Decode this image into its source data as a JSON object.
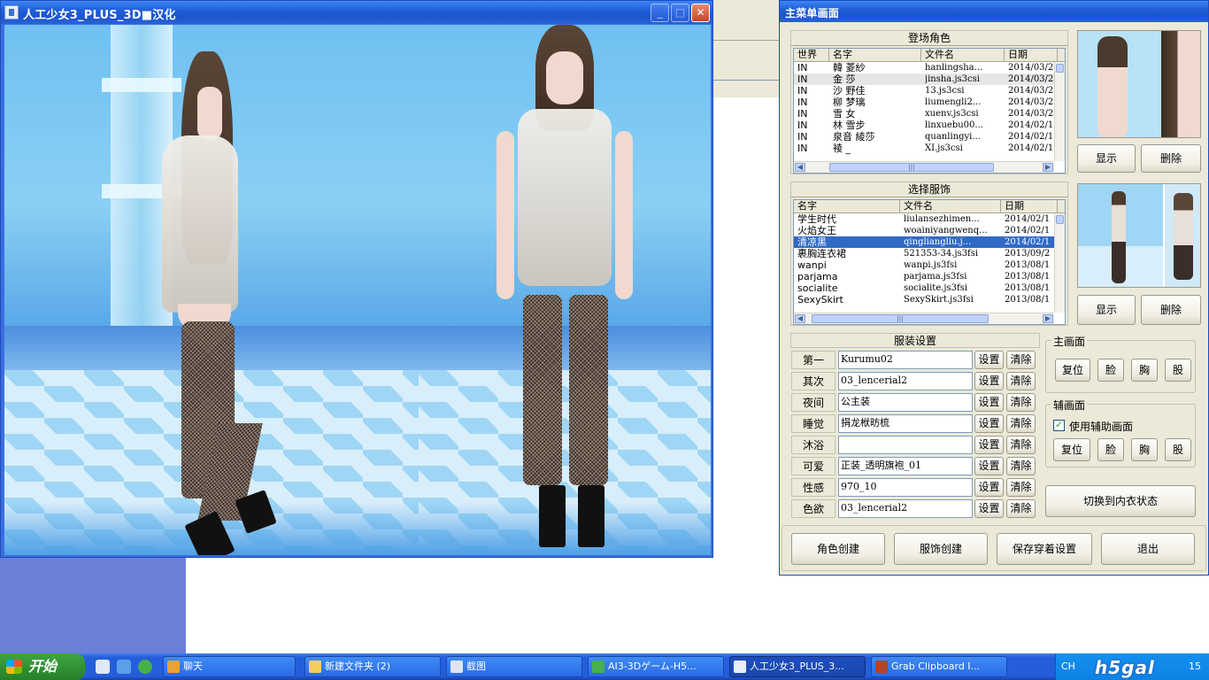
{
  "game_window": {
    "title": "人工少女3_PLUS_3D■汉化",
    "min_label": "_",
    "max_label": "□",
    "close_label": "✕"
  },
  "main_menu": {
    "title": "主菜单画面",
    "characters": {
      "header": "登场角色",
      "columns": [
        "世界",
        "名字",
        "文件名",
        "日期"
      ],
      "rows": [
        {
          "world": "IN",
          "name": "韓 菱紗",
          "file": "hanlingsha...",
          "date": "2014/03/2"
        },
        {
          "world": "IN",
          "name": "金 莎",
          "file": "jinsha.js3csi",
          "date": "2014/03/2"
        },
        {
          "world": "IN",
          "name": "沙 野佳",
          "file": "13.js3csi",
          "date": "2014/03/2"
        },
        {
          "world": "IN",
          "name": "柳 梦璃",
          "file": "liumengli2...",
          "date": "2014/03/2"
        },
        {
          "world": "IN",
          "name": "雪 女",
          "file": "xuenv.js3csi",
          "date": "2014/03/2"
        },
        {
          "world": "IN",
          "name": "林 雪步",
          "file": "linxuebu00...",
          "date": "2014/02/1"
        },
        {
          "world": "IN",
          "name": "泉音 綾莎",
          "file": "quanlingyi...",
          "date": "2014/02/1"
        },
        {
          "world": "IN",
          "name": "祾 _",
          "file": "XI.js3csi",
          "date": "2014/02/1"
        }
      ],
      "show_label": "显示",
      "delete_label": "删除"
    },
    "outfits": {
      "header": "选择服饰",
      "columns": [
        "名字",
        "文件名",
        "日期"
      ],
      "rows": [
        {
          "name": "学生时代",
          "file": "liulansezhimen...",
          "date": "2014/02/1"
        },
        {
          "name": "火焰女王",
          "file": "woainiyangwenq...",
          "date": "2014/02/1"
        },
        {
          "name": "清凉黑",
          "file": "qingliangliu.j...",
          "date": "2014/02/1"
        },
        {
          "name": "裹胸连衣裙",
          "file": "521353-34.js3fsi",
          "date": "2013/09/2"
        },
        {
          "name": "wanpi",
          "file": "wanpi.js3fsi",
          "date": "2013/08/1"
        },
        {
          "name": "parjama",
          "file": "parjama.js3fsi",
          "date": "2013/08/1"
        },
        {
          "name": "socialite",
          "file": "socialite.js3fsi",
          "date": "2013/08/1"
        },
        {
          "name": "SexySkirt",
          "file": "SexySkirt.js3fsi",
          "date": "2013/08/1"
        }
      ],
      "selected_index": 2,
      "show_label": "显示",
      "delete_label": "删除"
    },
    "costume_settings": {
      "header": "服装设置",
      "set_label": "设置",
      "clear_label": "清除",
      "slots": [
        {
          "label": "第一",
          "value": "Kurumu02"
        },
        {
          "label": "其次",
          "value": "03_lencerial2"
        },
        {
          "label": "夜间",
          "value": "公主装"
        },
        {
          "label": "睡觉",
          "value": "捐龙栿昉梳"
        },
        {
          "label": "沐浴",
          "value": ""
        },
        {
          "label": "可爱",
          "value": "正装_透明旗袍_01"
        },
        {
          "label": "性感",
          "value": "970_10"
        },
        {
          "label": "色欲",
          "value": "03_lencerial2"
        }
      ]
    },
    "main_view": {
      "title": "主画面",
      "buttons": [
        "复位",
        "脸",
        "胸",
        "股"
      ]
    },
    "sub_view": {
      "title": "辅画面",
      "checkbox_label": "使用辅助画面",
      "checked": true,
      "buttons": [
        "复位",
        "脸",
        "胸",
        "股"
      ]
    },
    "underwear_toggle_label": "切换到内衣状态",
    "bottom_buttons": [
      "角色创建",
      "服饰创建",
      "保存穿着设置",
      "退出"
    ]
  },
  "taskbar": {
    "start_label": "开始",
    "tasks": [
      {
        "label": "聊天",
        "icon_color": "#e8a23a"
      },
      {
        "label": "新建文件夹 (2)",
        "icon_color": "#f2cf5b"
      },
      {
        "label": "截图",
        "icon_color": "#dfe6f0"
      },
      {
        "label": "AI3-3Dゲーム-H5...",
        "icon_color": "#48b04a"
      },
      {
        "label": "人工少女3_PLUS_3...",
        "icon_color": "#e8eef8"
      },
      {
        "label": "Grab Clipboard I...",
        "icon_color": "#b0442e"
      }
    ],
    "active_task_index": 4,
    "tray_lang": "CH",
    "tray_logo": "h5gal",
    "tray_time": "15"
  }
}
